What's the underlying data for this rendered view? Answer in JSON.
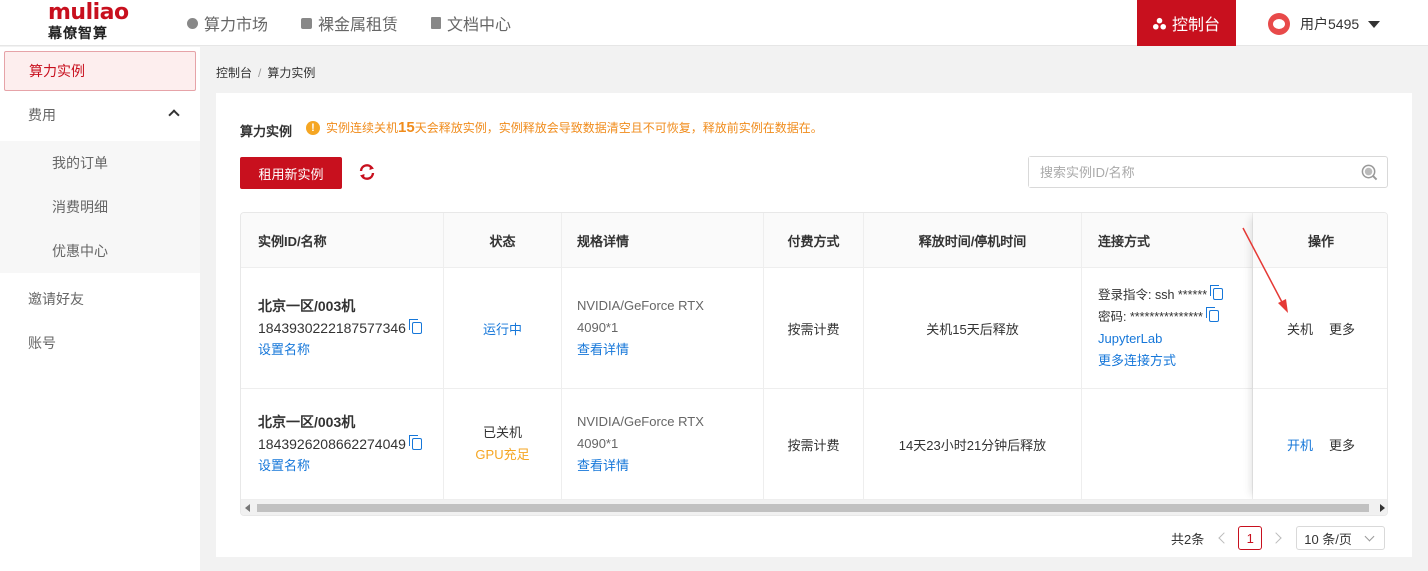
{
  "header": {
    "logo_main": "muliao",
    "logo_sub": "幕僚智算",
    "nav": [
      "算力市场",
      "裸金属租赁",
      "文档中心"
    ],
    "console_label": "控制台",
    "username": "用户5495"
  },
  "sidebar": {
    "items": [
      {
        "label": "算力实例"
      },
      {
        "label": "费用"
      },
      {
        "label": "我的订单"
      },
      {
        "label": "消费明细"
      },
      {
        "label": "优惠中心"
      },
      {
        "label": "邀请好友"
      },
      {
        "label": "账号"
      }
    ]
  },
  "breadcrumb": [
    "控制台",
    "算力实例"
  ],
  "panel": {
    "title": "算力实例",
    "warning_pre": "实例连续关机",
    "warning_num": "15",
    "warning_post": "天会释放实例，实例释放会导致数据清空且不可恢复，释放前实例在数据在。",
    "rent_button": "租用新实例",
    "search_placeholder": "搜索实例ID/名称"
  },
  "table": {
    "headers": [
      "实例ID/名称",
      "状态",
      "规格详情",
      "付费方式",
      "释放时间/停机时间",
      "连接方式",
      "操作"
    ],
    "rows": [
      {
        "name": "北京一区/003机",
        "id": "1843930222187577346",
        "set_name": "设置名称",
        "status": "运行中",
        "status_sub": "",
        "spec_1": "NVIDIA/GeForce RTX",
        "spec_2": "4090*1",
        "spec_link": "查看详情",
        "billing": "按需计费",
        "release": "关机15天后释放",
        "conn_login": "登录指令: ssh ******",
        "conn_password": "密码: ***************",
        "conn_jupyter": "JupyterLab",
        "conn_more": "更多连接方式",
        "op_primary": "关机",
        "op_more": "更多"
      },
      {
        "name": "北京一区/003机",
        "id": "1843926208662274049",
        "set_name": "设置名称",
        "status": "已关机",
        "status_sub": "GPU充足",
        "spec_1": "NVIDIA/GeForce RTX",
        "spec_2": "4090*1",
        "spec_link": "查看详情",
        "billing": "按需计费",
        "release": "14天23小时21分钟后释放",
        "op_primary": "开机",
        "op_more": "更多"
      }
    ]
  },
  "pagination": {
    "total": "共2条",
    "current_page": "1",
    "page_size": "10 条/页"
  },
  "colors": {
    "brand": "#c8101e",
    "link": "#1677d9",
    "warning": "#f08c1c"
  }
}
